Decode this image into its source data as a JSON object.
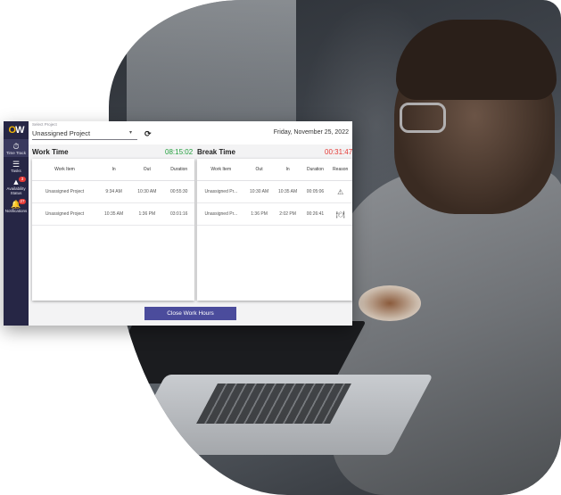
{
  "app": {
    "logo_o": "O",
    "logo_w": "W"
  },
  "sidebar": {
    "items": [
      {
        "label": "Time Track",
        "icon": "⏱",
        "badge": ""
      },
      {
        "label": "Tasks",
        "icon": "☰",
        "badge": ""
      },
      {
        "label": "Availability Status",
        "icon": "▲",
        "badge": "3"
      },
      {
        "label": "Notifications",
        "icon": "🔔",
        "badge": "27"
      }
    ]
  },
  "topbar": {
    "select_label": "Select Project",
    "select_value": "Unassigned Project",
    "date": "Friday, November 25, 2022"
  },
  "work": {
    "title": "Work Time",
    "total": "08:15:02",
    "columns": [
      "Work Item",
      "In",
      "Out",
      "Duration"
    ],
    "rows": [
      [
        "Unassigned Project",
        "9:34 AM",
        "10:30 AM",
        "00:55:30"
      ],
      [
        "Unassigned Project",
        "10:35 AM",
        "1:36 PM",
        "03:01:16"
      ]
    ]
  },
  "break": {
    "title": "Break Time",
    "total": "00:31:47",
    "columns": [
      "Work Item",
      "Out",
      "In",
      "Duration",
      "Reason"
    ],
    "rows": [
      [
        "Unassigned Pr...",
        "10:30 AM",
        "10:35 AM",
        "00:05:06",
        "⚠"
      ],
      [
        "Unassigned Pr...",
        "1:36 PM",
        "2:02 PM",
        "00:26:41",
        "🍽"
      ]
    ]
  },
  "actions": {
    "close_label": "Close Work Hours"
  },
  "colors": {
    "sidebar_bg": "#262645",
    "accent_button": "#4b4c9c",
    "work_total": "#1f9d3a",
    "break_total": "#e53935"
  }
}
